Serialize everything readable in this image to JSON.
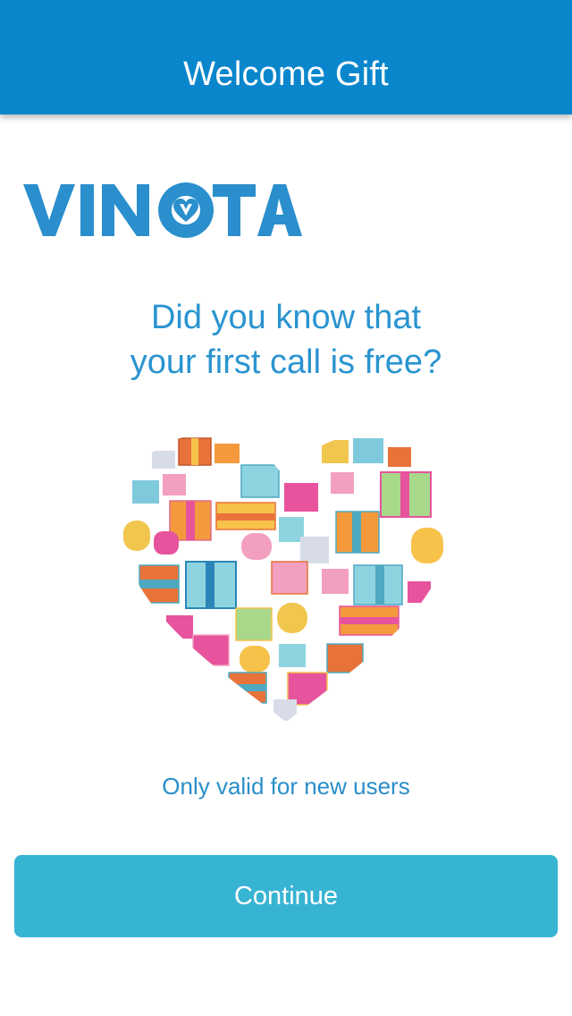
{
  "header": {
    "title": "Welcome Gift",
    "color": "#0a86cc"
  },
  "logo": {
    "text": "VINOTA",
    "color": "#2a8fcc",
    "icon": "heart-in-o-icon"
  },
  "main": {
    "headline_line1": "Did you know that",
    "headline_line2": "your first call is free?",
    "illustration": "gift-boxes-heart-illustration",
    "note": "Only valid for new users"
  },
  "actions": {
    "continue_label": "Continue",
    "continue_color": "#38b4d3"
  }
}
